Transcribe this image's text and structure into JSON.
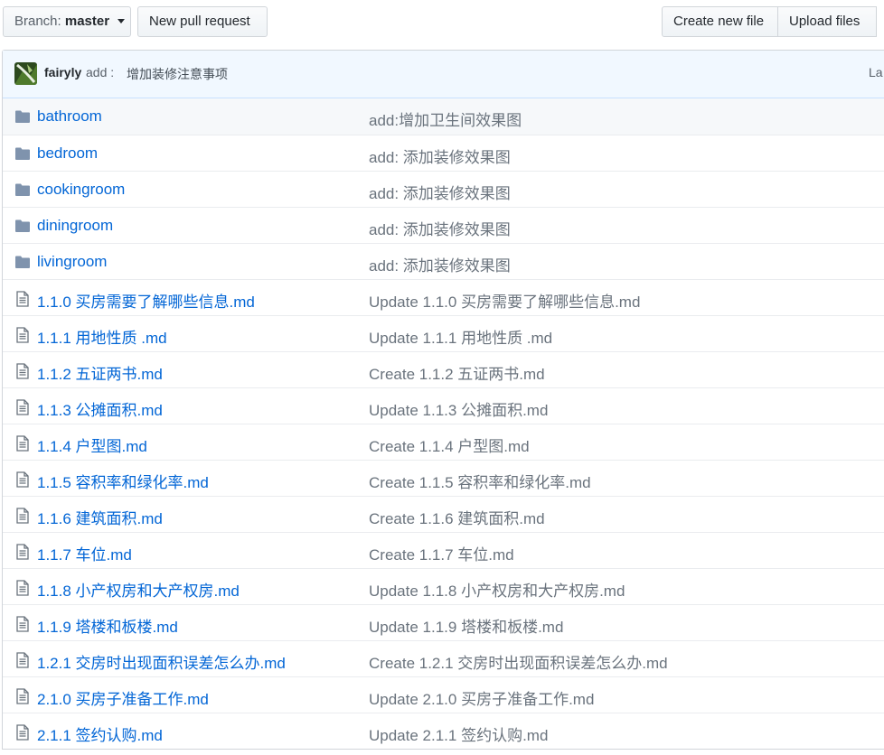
{
  "toolbar": {
    "branch_label": "Branch:",
    "branch_value": "master",
    "new_pr_label": "New pull request",
    "create_file_label": "Create new file",
    "upload_files_label": "Upload files"
  },
  "commit": {
    "author": "fairyly",
    "verb": "add :",
    "message": "增加装修注意事项",
    "time_fragment": "La"
  },
  "files": [
    {
      "type": "directory",
      "name": "bathroom",
      "commit": "add:增加卫生间效果图"
    },
    {
      "type": "directory",
      "name": "bedroom",
      "commit": "add: 添加装修效果图"
    },
    {
      "type": "directory",
      "name": "cookingroom",
      "commit": "add: 添加装修效果图"
    },
    {
      "type": "directory",
      "name": "diningroom",
      "commit": "add: 添加装修效果图"
    },
    {
      "type": "directory",
      "name": "livingroom",
      "commit": "add: 添加装修效果图"
    },
    {
      "type": "file",
      "name": "1.1.0 买房需要了解哪些信息.md",
      "commit": "Update 1.1.0 买房需要了解哪些信息.md"
    },
    {
      "type": "file",
      "name": "1.1.1 用地性质 .md",
      "commit": "Update 1.1.1 用地性质 .md"
    },
    {
      "type": "file",
      "name": "1.1.2 五证两书.md",
      "commit": "Create 1.1.2 五证两书.md"
    },
    {
      "type": "file",
      "name": "1.1.3 公摊面积.md",
      "commit": "Update 1.1.3 公摊面积.md"
    },
    {
      "type": "file",
      "name": "1.1.4 户型图.md",
      "commit": "Create 1.1.4 户型图.md"
    },
    {
      "type": "file",
      "name": "1.1.5 容积率和绿化率.md",
      "commit": "Create 1.1.5 容积率和绿化率.md"
    },
    {
      "type": "file",
      "name": "1.1.6 建筑面积.md",
      "commit": "Create 1.1.6 建筑面积.md"
    },
    {
      "type": "file",
      "name": "1.1.7 车位.md",
      "commit": "Create 1.1.7 车位.md"
    },
    {
      "type": "file",
      "name": "1.1.8 小产权房和大产权房.md",
      "commit": "Update 1.1.8 小产权房和大产权房.md"
    },
    {
      "type": "file",
      "name": "1.1.9 塔楼和板楼.md",
      "commit": "Update 1.1.9 塔楼和板楼.md"
    },
    {
      "type": "file",
      "name": "1.2.1 交房时出现面积误差怎么办.md",
      "commit": "Create 1.2.1 交房时出现面积误差怎么办.md"
    },
    {
      "type": "file",
      "name": "2.1.0 买房子准备工作.md",
      "commit": "Update 2.1.0 买房子准备工作.md"
    },
    {
      "type": "file",
      "name": "2.1.1 签约认购.md",
      "commit": "Update 2.1.1 签约认购.md"
    }
  ],
  "colors": {
    "link": "#0366d6",
    "folder_icon": "#79b8ff",
    "file_icon": "#6a737d",
    "commit_bar": "#f1f8ff"
  }
}
